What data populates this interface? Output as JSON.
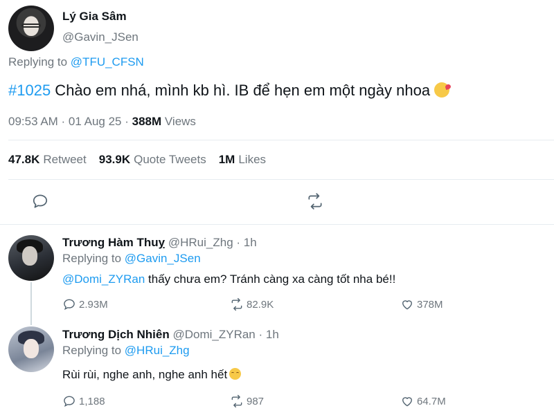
{
  "tweet": {
    "name": "Lý Gia Sâm",
    "handle": "@Gavin_JSen",
    "replying_prefix": "Replying to",
    "replying_to": "@TFU_CFSN",
    "hashtag": "#1025",
    "text": " Chào em nhá, mình kb hì. IB để hẹn em một ngày nhoa ",
    "time": "09:53 AM · 01 Aug 25 · ",
    "views": "388M",
    "views_label": " Views",
    "stats": {
      "retweets": "47.8K",
      "retweets_label": "Retweet",
      "quotes": "93.9K",
      "quotes_label": "Quote Tweets",
      "likes": "1M",
      "likes_label": "Likes"
    },
    "icons": [
      "reply-icon",
      "retweet-icon",
      "emoji-kiss-icon"
    ]
  },
  "replies": [
    {
      "name": "Trương Hàm Thuỵ",
      "handle": " @HRui_Zhg · 1h",
      "replying_prefix": "Replying to",
      "replying_to": "@Gavin_JSen",
      "mention": "@Domi_ZYRan",
      "text": " thấy chưa em? Tránh càng xa càng tốt nha bé!!",
      "replies": "2.93M",
      "retweets": "82.9K",
      "likes": "378M"
    },
    {
      "name": "Trương Dịch Nhiên",
      "handle": " @Domi_ZYRan · 1h",
      "replying_prefix": "Replying to",
      "replying_to": "@HRui_Zhg",
      "text": "Rùi rùi, nghe anh, nghe anh hết",
      "replies": "1,188",
      "retweets": "987",
      "likes": "64.7M"
    }
  ],
  "colors": {
    "accent": "#1d9bf0",
    "muted": "#6e767d",
    "text": "#0f1419",
    "divider": "#e6ecf0"
  }
}
